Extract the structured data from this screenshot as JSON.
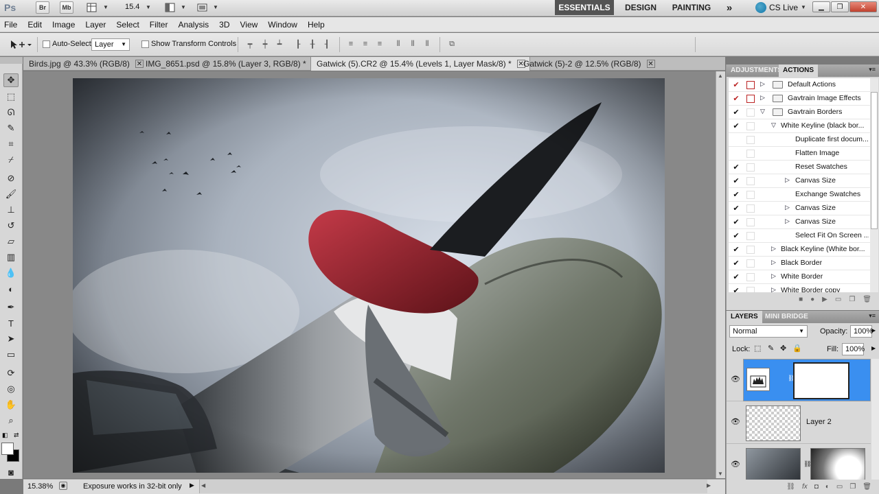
{
  "app": {
    "logo": "Ps",
    "bridge": "Br",
    "minibridge": "Mb",
    "zoom": "15.4",
    "workspaces": [
      {
        "label": "ESSENTIALS",
        "active": true
      },
      {
        "label": "DESIGN",
        "active": false
      },
      {
        "label": "PAINTING",
        "active": false
      }
    ],
    "more": "»",
    "cslive": "CS Live"
  },
  "menu": [
    "File",
    "Edit",
    "Image",
    "Layer",
    "Select",
    "Filter",
    "Analysis",
    "3D",
    "View",
    "Window",
    "Help"
  ],
  "options": {
    "auto_select_label": "Auto-Select:",
    "auto_select_value": "Layer",
    "show_transform_label": "Show Transform Controls"
  },
  "tabs": [
    {
      "label": "Birds.jpg @ 43.3% (RGB/8)",
      "active": false
    },
    {
      "label": "IMG_8651.psd @ 15.8% (Layer 3, RGB/8) *",
      "active": false
    },
    {
      "label": "Gatwick (5).CR2 @ 15.4% (Levels 1, Layer Mask/8) *",
      "active": true
    },
    {
      "label": "Gatwick (5)-2 @ 12.5% (RGB/8)",
      "active": false
    }
  ],
  "status": {
    "zoom": "15.38%",
    "message": "Exposure works in 32-bit only"
  },
  "actions_panel": {
    "tabs": [
      "ADJUSTMENTS",
      "ACTIONS"
    ],
    "active_tab": "ACTIONS",
    "rows": [
      {
        "label": "Default Actions",
        "level": 0,
        "check": "✔",
        "dialog": "red",
        "expanded": false,
        "folder": true
      },
      {
        "label": "Gavtrain Image Effects",
        "level": 0,
        "check": "✔",
        "dialog": "red",
        "expanded": false,
        "folder": true
      },
      {
        "label": "Gavtrain Borders",
        "level": 0,
        "check": "✔",
        "dialog": "none",
        "expanded": true,
        "folder": true
      },
      {
        "label": "White Keyline (black bor...",
        "level": 1,
        "check": "✔",
        "dialog": "none",
        "expanded": true,
        "folder": false
      },
      {
        "label": "Duplicate first docum...",
        "level": 2,
        "check": "",
        "dialog": "none",
        "expanded": null,
        "folder": false
      },
      {
        "label": "Flatten Image",
        "level": 2,
        "check": "",
        "dialog": "none",
        "expanded": null,
        "folder": false
      },
      {
        "label": "Reset Swatches",
        "level": 2,
        "check": "✔",
        "dialog": "none",
        "expanded": null,
        "folder": false
      },
      {
        "label": "Canvas Size",
        "level": 2,
        "check": "✔",
        "dialog": "none",
        "expanded": false,
        "folder": false
      },
      {
        "label": "Exchange Swatches",
        "level": 2,
        "check": "✔",
        "dialog": "none",
        "expanded": null,
        "folder": false
      },
      {
        "label": "Canvas Size",
        "level": 2,
        "check": "✔",
        "dialog": "none",
        "expanded": false,
        "folder": false
      },
      {
        "label": "Canvas Size",
        "level": 2,
        "check": "✔",
        "dialog": "none",
        "expanded": false,
        "folder": false
      },
      {
        "label": "Select Fit On Screen ...",
        "level": 2,
        "check": "✔",
        "dialog": "none",
        "expanded": null,
        "folder": false
      },
      {
        "label": "Black Keyline (White bor...",
        "level": 1,
        "check": "✔",
        "dialog": "none",
        "expanded": false,
        "folder": false
      },
      {
        "label": "Black Border",
        "level": 1,
        "check": "✔",
        "dialog": "none",
        "expanded": false,
        "folder": false
      },
      {
        "label": "White Border",
        "level": 1,
        "check": "✔",
        "dialog": "none",
        "expanded": false,
        "folder": false
      },
      {
        "label": "White Border copy",
        "level": 1,
        "check": "✔",
        "dialog": "none",
        "expanded": false,
        "folder": false
      }
    ]
  },
  "layers_panel": {
    "tabs": [
      "LAYERS",
      "MINI BRIDGE"
    ],
    "active_tab": "LAYERS",
    "blend_mode": "Normal",
    "opacity_label": "Opacity:",
    "opacity": "100%",
    "lock_label": "Lock:",
    "fill_label": "Fill:",
    "fill": "100%",
    "layers": [
      {
        "name": "",
        "selected": true,
        "type": "adjustment"
      },
      {
        "name": "Layer 2",
        "selected": false,
        "type": "transparent"
      },
      {
        "name": "",
        "selected": false,
        "type": "photo"
      }
    ]
  }
}
